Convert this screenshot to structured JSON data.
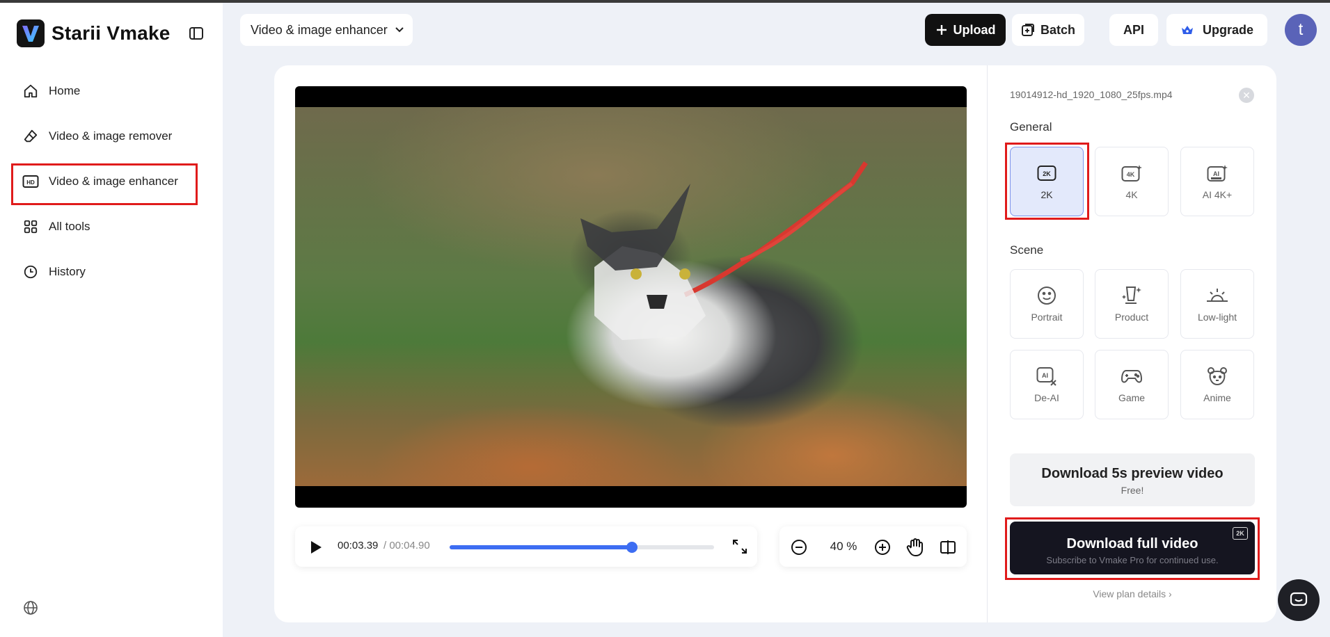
{
  "app": {
    "name": "Starii Vmake"
  },
  "nav": {
    "items": [
      {
        "label": "Home",
        "icon": "home-icon"
      },
      {
        "label": "Video & image remover",
        "icon": "eraser-icon"
      },
      {
        "label": "Video & image enhancer",
        "icon": "hd-icon"
      },
      {
        "label": "All tools",
        "icon": "grid-icon"
      },
      {
        "label": "History",
        "icon": "clock-icon"
      }
    ],
    "active": "Video & image enhancer"
  },
  "topbar": {
    "tool_select": "Video & image enhancer",
    "upload": "Upload",
    "batch": "Batch",
    "api": "API",
    "upgrade": "Upgrade",
    "avatar_letter": "t"
  },
  "player": {
    "current_time": "00:03.39",
    "total_time": "/ 00:04.90",
    "progress": 0.69,
    "zoom": "40 %"
  },
  "panel": {
    "filename": "19014912-hd_1920_1080_25fps.mp4",
    "general_title": "General",
    "general_options": [
      {
        "label": "2K",
        "icon": "2k-icon",
        "selected": true
      },
      {
        "label": "4K",
        "icon": "4k-icon",
        "selected": false
      },
      {
        "label": "AI 4K+",
        "icon": "ai-4k-icon",
        "selected": false
      }
    ],
    "scene_title": "Scene",
    "scene_options": [
      {
        "label": "Portrait",
        "icon": "smiley-icon"
      },
      {
        "label": "Product",
        "icon": "product-icon"
      },
      {
        "label": "Low-light",
        "icon": "low-light-icon"
      },
      {
        "label": "De-AI",
        "icon": "de-ai-icon"
      },
      {
        "label": "Game",
        "icon": "gamepad-icon"
      },
      {
        "label": "Anime",
        "icon": "bear-icon"
      }
    ],
    "preview_title": "Download 5s preview video",
    "preview_sub": "Free!",
    "full_title": "Download full video",
    "full_sub": "Subscribe to Vmake Pro for continued use.",
    "full_badge": "2K",
    "plan_link": "View plan details",
    "plan_link_chevron": "›"
  },
  "colors": {
    "accent": "#3d6df2",
    "highlight": "#e01b1b",
    "dark": "#151520"
  }
}
